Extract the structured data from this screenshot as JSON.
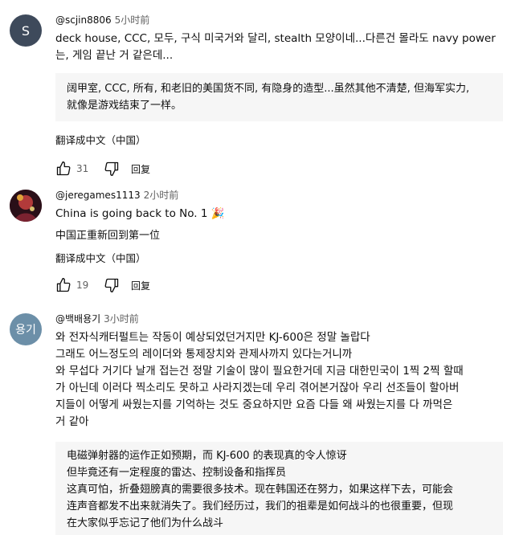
{
  "comments": [
    {
      "avatar_letter": "S",
      "avatar_color": "#3e4a5b",
      "username": "@scjin8806",
      "time": "5小时前",
      "text": "deck house, CCC, 모두, 구식 미국거와 달리, stealth 모양이네...다른건 몰라도 navy power\n는, 게임 끝난 거 같은데...",
      "translation": "阔甲室, CCC, 所有, 和老旧的美国货不同, 有隐身的造型...虽然其他不清楚, 但海军实力,\n就像是游戏结束了一样。",
      "translate_label": "翻译成中文（中国）",
      "likes": "31",
      "reply_label": "回复"
    },
    {
      "avatar_color": "#6b1f2a",
      "username": "@jeregames1113",
      "time": "2小时前",
      "text": "China is going back to No. 1 🎉",
      "translation": "中国正重新回到第一位",
      "translate_label": "翻译成中文（中国）",
      "likes": "19",
      "reply_label": "回复"
    },
    {
      "avatar_letter": "용기",
      "avatar_color": "#6c8fa8",
      "username": "@백배용기",
      "time": "3小时前",
      "text": "와 전자식캐터펄트는 작동이 예상되었던거지만 KJ-600은 정말 놀랍다\n그래도 어느정도의 레이더와 통제장치와 관제사까지 있다는거니까\n와 무섭다 거기다 날개 접는건 정말 기술이 많이 필요한거데 지금 대한민국이 1찍 2찍 할때\n가 아닌데 이러다 찍소리도 못하고 사라지겠는데 우리 겪어본거잖아 우리 선조들이 할아버\n지들이 어떻게 싸웠는지를 기억하는 것도 중요하지만 요즘 다들 왜 싸웠는지를 다 까먹은\n거 같아",
      "translation": "电磁弹射器的运作正如预期，而 KJ-600 的表现真的令人惊讶\n但毕竟还有一定程度的雷达、控制设备和指挥员\n这真可怕，折叠翅膀真的需要很多技术。现在韩国还在努力，如果这样下去，可能会\n连声音都发不出来就消失了。我们经历过，我们的祖辈是如何战斗的也很重要，但现\n在大家似乎忘记了他们为什么战斗"
    }
  ]
}
